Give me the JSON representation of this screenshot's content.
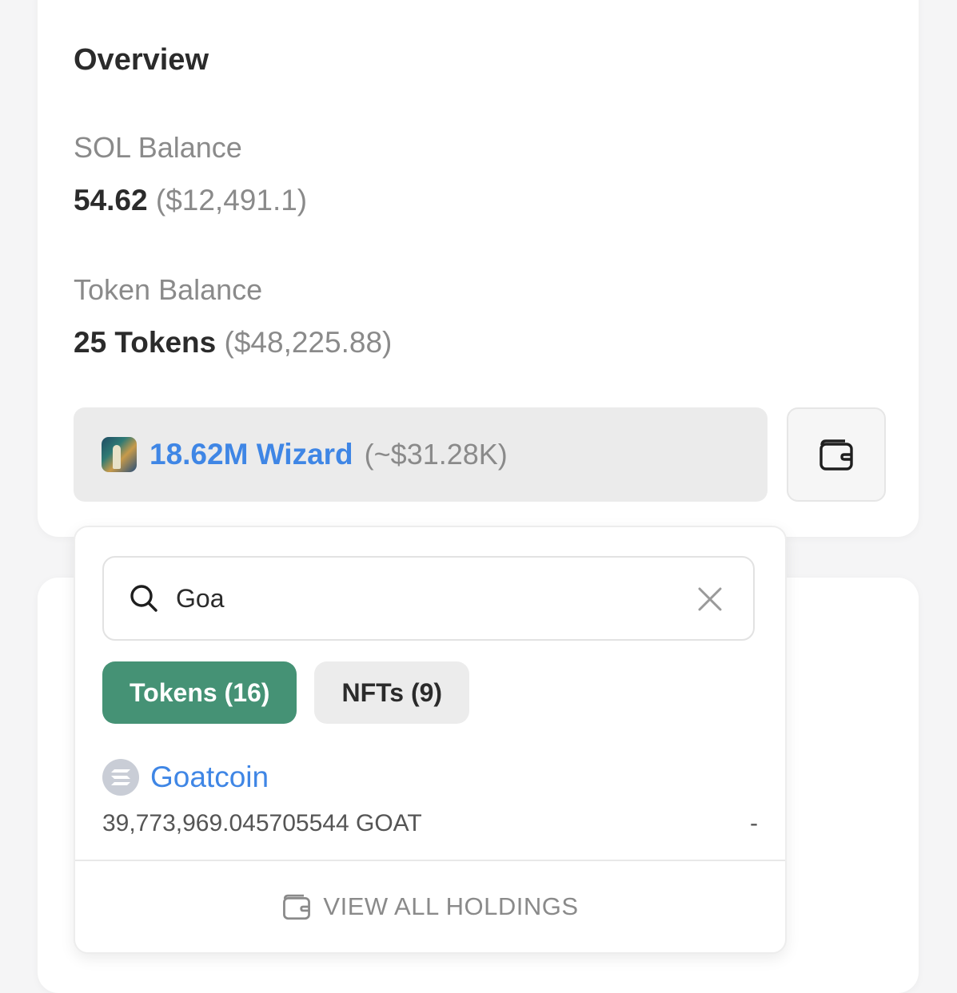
{
  "overview": {
    "title": "Overview",
    "sol_label": "SOL Balance",
    "sol_amount": "54.62",
    "sol_usd": "($12,491.1)",
    "token_label": "Token Balance",
    "token_count": "25 Tokens",
    "token_usd": "($48,225.88)"
  },
  "selected_token": {
    "amount": "18.62M Wizard",
    "value": "(~$31.28K)",
    "icon": "wizard-token-icon"
  },
  "wallet_button": {
    "icon": "wallet-icon"
  },
  "dropdown": {
    "search": {
      "value": "Goa",
      "placeholder": "",
      "icon": "search-icon",
      "clear_icon": "close-icon"
    },
    "tabs": [
      {
        "label": "Tokens (16)",
        "active": true
      },
      {
        "label": "NFTs (9)",
        "active": false
      }
    ],
    "results": [
      {
        "name": "Goatcoin",
        "amount": "39,773,969.045705544 GOAT",
        "value": "-",
        "icon": "solana-icon"
      }
    ],
    "view_all_label": "VIEW ALL HOLDINGS",
    "view_all_icon": "wallet-icon"
  },
  "colors": {
    "accent_blue": "#3f86e5",
    "accent_green": "#459275",
    "muted_text": "#8a8a8a"
  }
}
